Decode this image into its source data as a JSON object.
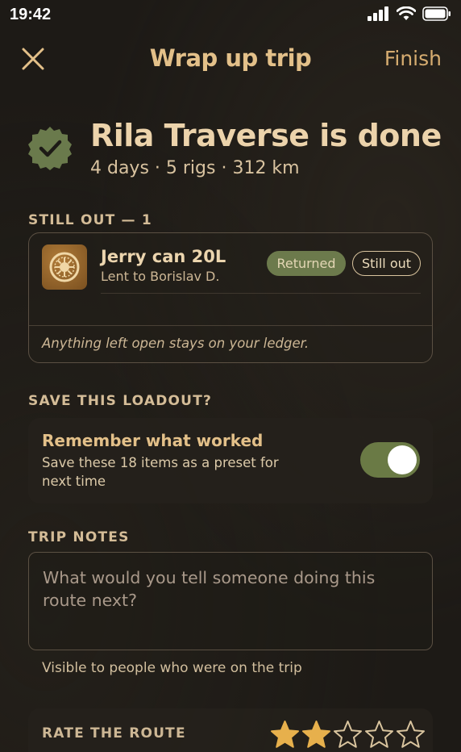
{
  "status": {
    "time": "19:42"
  },
  "nav": {
    "title": "Wrap up trip",
    "finish_label": "Finish"
  },
  "trip": {
    "title": "Rila Traverse is done",
    "summary": "4 days · 5 rigs · 312 km"
  },
  "still_out": {
    "label": "STILL OUT — 1",
    "items": [
      {
        "name": "Jerry can 20L",
        "lent_to": "Lent to Borislav D.",
        "returned_label": "Returned",
        "still_out_label": "Still out",
        "icon": "tire-icon"
      }
    ],
    "footer": "Anything left open stays on your ledger."
  },
  "loadout": {
    "label": "SAVE THIS LOADOUT?",
    "title": "Remember what worked",
    "description": "Save these 18 items as a preset for next time",
    "toggle_on": true
  },
  "notes": {
    "label": "TRIP NOTES",
    "placeholder": "What would you tell someone doing this route next?",
    "hint": "Visible to people who were on the trip"
  },
  "rating": {
    "label": "RATE THE ROUTE",
    "value": 2,
    "max": 5
  },
  "colors": {
    "accent": "#e3c089",
    "green": "#6a7a45",
    "background": "#1d1a16"
  }
}
